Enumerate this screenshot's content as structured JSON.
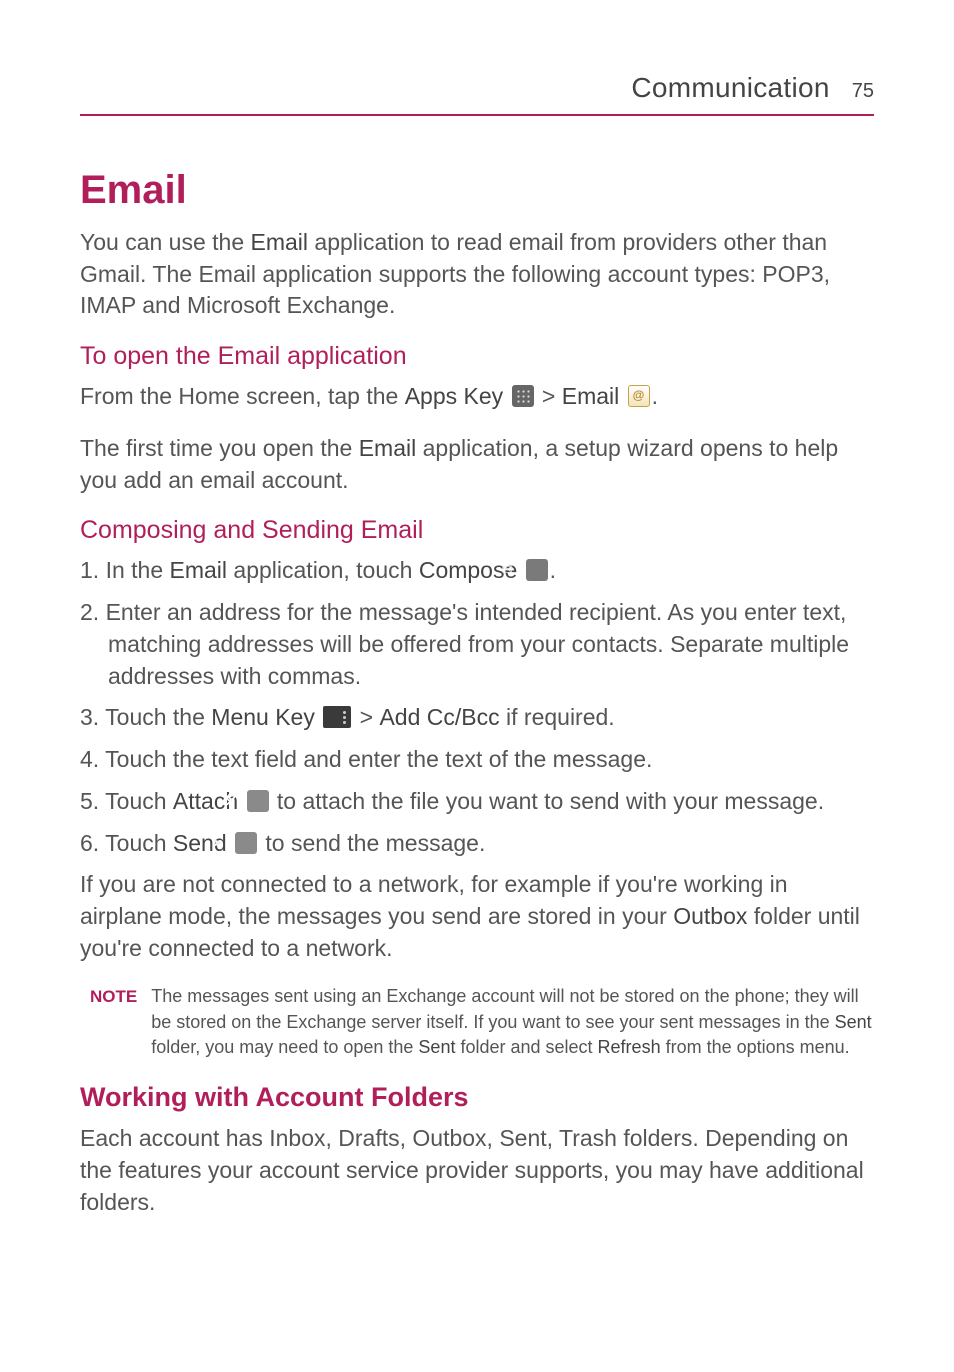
{
  "header": {
    "section": "Communication",
    "page_number": "75"
  },
  "email": {
    "title": "Email",
    "intro_pre": "You can use the ",
    "intro_bold": "Email",
    "intro_post": " application to read email from providers other than Gmail. The Email application supports the following account types: POP3, IMAP and Microsoft Exchange.",
    "open": {
      "heading": "To open the Email application",
      "line1_pre": "From the Home screen, tap the ",
      "line1_apps": "Apps Key",
      "line1_gt": " > ",
      "line1_email": "Email",
      "line1_end": ".",
      "line2_pre": "The first time you open the ",
      "line2_bold": "Email",
      "line2_post": " application, a setup wizard opens to help you add an email account."
    },
    "compose": {
      "heading": "Composing and Sending Email",
      "s1_num": "1. ",
      "s1_pre": "In the ",
      "s1_b1": "Email",
      "s1_mid": " application, touch ",
      "s1_b2": "Compose",
      "s1_end": ".",
      "s2_num": "2. ",
      "s2_text": "Enter an address for the message's intended recipient. As you enter text, matching addresses will be offered from your contacts. Separate multiple addresses with commas.",
      "s3_num": "3. ",
      "s3_pre": "Touch the ",
      "s3_b1": "Menu Key",
      "s3_gt": " > ",
      "s3_b2": "Add Cc/Bcc",
      "s3_post": " if required.",
      "s4_num": "4. ",
      "s4_text": "Touch the text field and enter the text of the message.",
      "s5_num": "5. ",
      "s5_pre": "Touch ",
      "s5_b1": "Attach",
      "s5_post": " to attach the file you want to send with your message.",
      "s6_num": "6. ",
      "s6_pre": "Touch ",
      "s6_b1": "Send",
      "s6_post": " to send the message.",
      "outbox_pre": "If you are not connected to a network, for example if you're working in airplane mode, the messages you send are stored in your ",
      "outbox_b": "Outbox",
      "outbox_post": " folder until you're connected to a network."
    },
    "note": {
      "label": "NOTE",
      "t1": "The messages sent using an Exchange account will not be stored on the phone; they will be stored on the Exchange server itself. If you want to see your sent messages in the ",
      "b1": "Sent",
      "t2": " folder, you may need to open the ",
      "b2": "Sent",
      "t3": " folder and select ",
      "b3": "Refresh",
      "t4": " from the options menu."
    }
  },
  "folders": {
    "heading": "Working with Account Folders",
    "text": "Each account has Inbox, Drafts, Outbox, Sent, Trash folders. Depending on the features your account service provider supports, you may have additional folders."
  }
}
